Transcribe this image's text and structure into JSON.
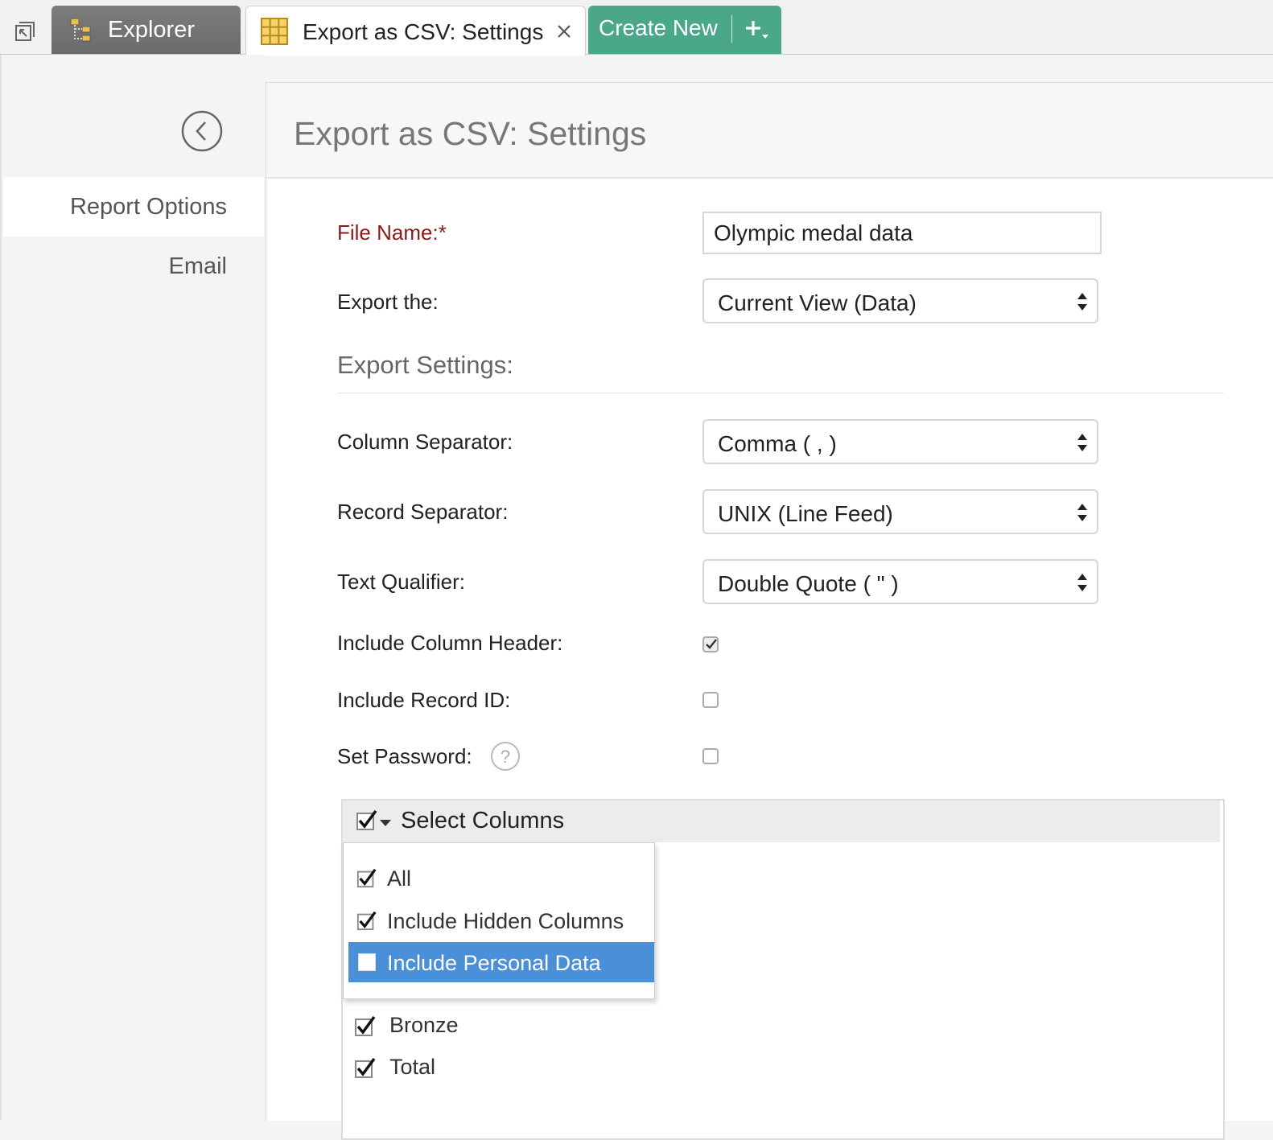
{
  "tabs": {
    "explorer": {
      "label": "Explorer",
      "icon": "explorer-tree-icon"
    },
    "active": {
      "label": "Export as CSV: Settings",
      "icon": "table-grid-icon",
      "close_icon": "close-icon"
    },
    "create": {
      "label": "Create New",
      "icon": "plus-dropdown-icon",
      "color": "#4aa78a"
    }
  },
  "sidebar": {
    "back_icon": "chevron-left-circle-icon",
    "items": [
      {
        "label": "Report Options",
        "active": true
      },
      {
        "label": "Email",
        "active": false
      }
    ]
  },
  "page": {
    "title": "Export as CSV: Settings"
  },
  "form": {
    "file_name": {
      "label": "File Name:*",
      "value": "Olympic medal data"
    },
    "export_the": {
      "label": "Export the:",
      "value": "Current View (Data)"
    },
    "section_title": "Export Settings:",
    "column_separator": {
      "label": "Column Separator:",
      "value": "Comma ( , )"
    },
    "record_separator": {
      "label": "Record Separator:",
      "value": "UNIX (Line Feed)"
    },
    "text_qualifier": {
      "label": "Text Qualifier:",
      "value": "Double Quote ( \" )"
    },
    "include_column_header": {
      "label": "Include Column Header:",
      "checked": true
    },
    "include_record_id": {
      "label": "Include Record ID:",
      "checked": false
    },
    "set_password": {
      "label": "Set Password:",
      "checked": false,
      "help_icon": "question-mark-icon"
    }
  },
  "columns": {
    "header_label": "Select Columns",
    "dropdown": [
      {
        "label": "All",
        "checked": true
      },
      {
        "label": "Include Hidden Columns",
        "checked": true
      },
      {
        "label": "Include Personal Data",
        "checked": false,
        "highlighted": true
      }
    ],
    "items": [
      {
        "label": "Bronze",
        "checked": true
      },
      {
        "label": "Total",
        "checked": true
      }
    ]
  },
  "colors": {
    "highlight": "#4a90d9",
    "required_label": "#8b1a1a",
    "explorer_tab": "#707070"
  }
}
